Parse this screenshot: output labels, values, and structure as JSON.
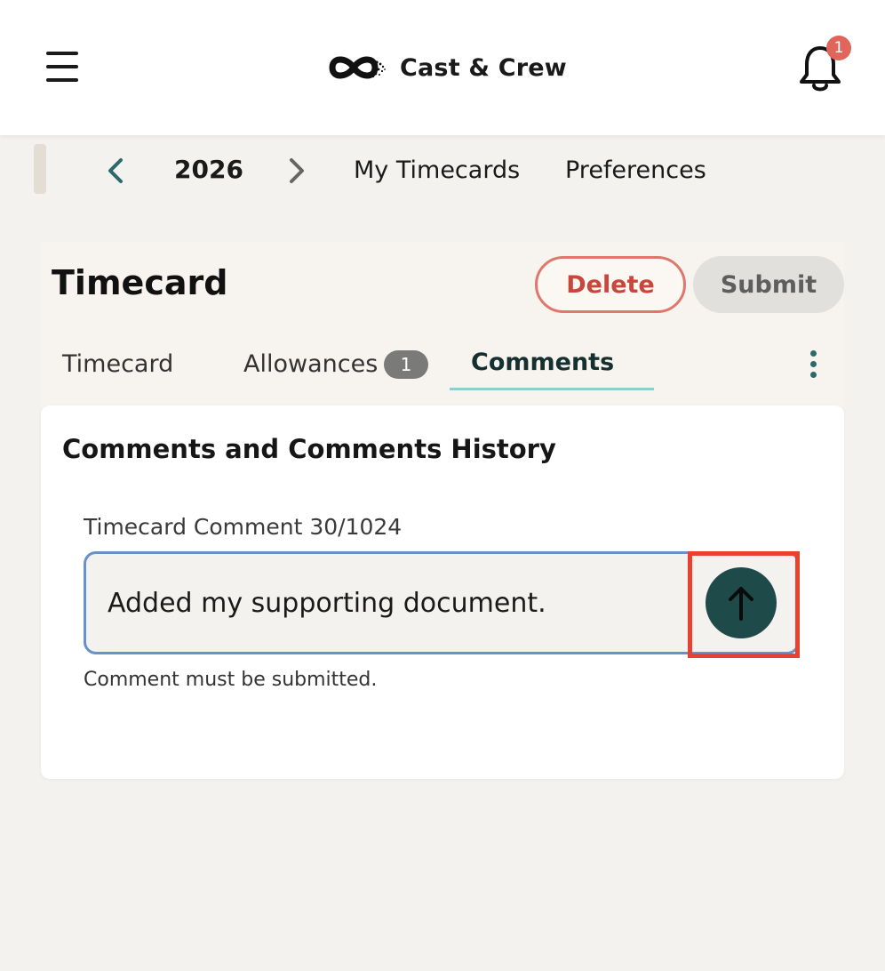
{
  "header": {
    "brand_name": "Cast & Crew",
    "notification_count": "1",
    "icons": {
      "menu": "hamburger-menu-icon",
      "logo": "infinity-logo-icon",
      "bell": "bell-icon"
    }
  },
  "year_nav": {
    "year": "2026",
    "links": [
      "My Timecards",
      "Preferences"
    ]
  },
  "timecard": {
    "title": "Timecard",
    "delete_label": "Delete",
    "submit_label": "Submit",
    "tabs": [
      {
        "label": "Timecard"
      },
      {
        "label": "Allowances",
        "badge": "1"
      },
      {
        "label": "Comments",
        "active": true
      }
    ]
  },
  "comments": {
    "title": "Comments and Comments History",
    "field_label": "Timecard Comment 30/1024",
    "value": "Added my supporting document.",
    "helper": "Comment must be submitted.",
    "send_icon": "arrow-up-icon"
  },
  "colors": {
    "accent_teal": "#1f4a4a",
    "tab_underline": "#8ccfcf",
    "delete_red": "#c9463c",
    "badge_red": "#e0655a",
    "input_border": "#6a90c8",
    "highlight_red": "#e8412f"
  }
}
